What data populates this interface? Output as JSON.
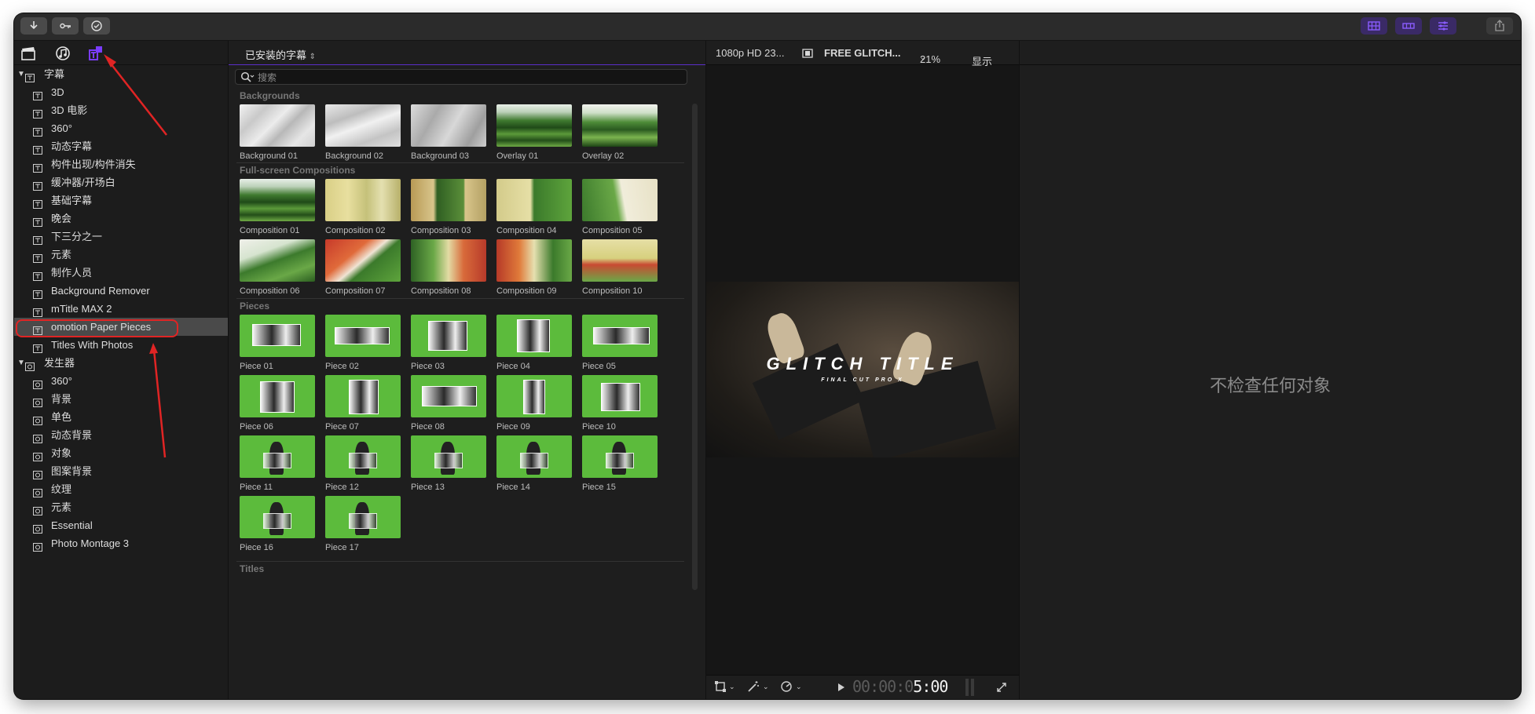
{
  "toolbar": {
    "left_icons": [
      "download-icon",
      "key-icon",
      "checkmark-circle-icon"
    ],
    "right_icons": [
      "grid-layout-icon",
      "timeline-layout-icon",
      "inspector-sliders-icon",
      "share-icon"
    ]
  },
  "sidebar": {
    "tab_icons": [
      "clapper-icon",
      "music-icon",
      "titles-generators-icon"
    ],
    "groups": [
      {
        "label": "字幕",
        "items": [
          "3D",
          "3D 电影",
          "360°",
          "动态字幕",
          "构件出现/构件消失",
          "缓冲器/开场白",
          "基础字幕",
          "晚会",
          "下三分之一",
          "元素",
          "制作人员",
          "Background Remover",
          "mTitle MAX 2",
          "omotion Paper Pieces",
          "Titles With Photos"
        ],
        "selected": "omotion Paper Pieces"
      },
      {
        "label": "发生器",
        "items": [
          "360°",
          "背景",
          "单色",
          "动态背景",
          "对象",
          "图案背景",
          "纹理",
          "元素",
          "Essential",
          "Photo Montage 3"
        ]
      }
    ]
  },
  "browser": {
    "title": "已安装的字幕",
    "search_placeholder": "搜索",
    "sections": [
      {
        "title": "Backgrounds",
        "items": [
          "Background 01",
          "Background 02",
          "Background 03",
          "Overlay 01",
          "Overlay 02"
        ]
      },
      {
        "title": "Full-screen Compositions",
        "items": [
          "Composition 01",
          "Composition 02",
          "Composition 03",
          "Composition 04",
          "Composition 05",
          "Composition 06",
          "Composition 07",
          "Composition 08",
          "Composition 09",
          "Composition 10"
        ]
      },
      {
        "title": "Pieces",
        "items": [
          "Piece 01",
          "Piece 02",
          "Piece 03",
          "Piece 04",
          "Piece 05",
          "Piece 06",
          "Piece 07",
          "Piece 08",
          "Piece 09",
          "Piece 10",
          "Piece 11",
          "Piece 12",
          "Piece 13",
          "Piece 14",
          "Piece 15",
          "Piece 16",
          "Piece 17"
        ]
      },
      {
        "title": "Titles",
        "items": []
      }
    ]
  },
  "viewer": {
    "format": "1080p HD 23...",
    "clip_name": "FREE GLITCH...",
    "zoom": "21%",
    "display_menu": "显示",
    "preview_title": "GLITCH TITLE",
    "preview_subtitle": "FINAL CUT PRO X",
    "timecode_dim": "00:00:0",
    "timecode_bright": "5:00"
  },
  "inspector": {
    "message": "不检查任何对象"
  },
  "colors": {
    "accent_purple": "#6a3cff",
    "annotation_red": "#e02424",
    "chroma_green": "#5cbb3c"
  }
}
